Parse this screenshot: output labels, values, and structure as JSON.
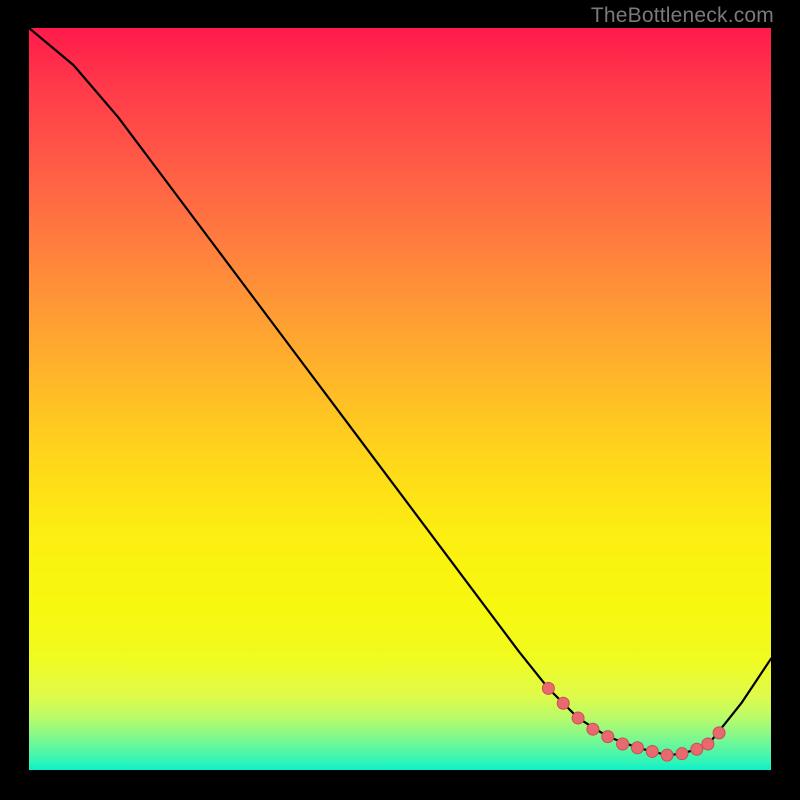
{
  "attribution": "TheBottleneck.com",
  "colors": {
    "curve_stroke": "#000000",
    "marker_fill": "#e86a6f",
    "marker_stroke": "#c94f55"
  },
  "chart_data": {
    "type": "line",
    "title": "",
    "xlabel": "",
    "ylabel": "",
    "xlim": [
      0,
      100
    ],
    "ylim": [
      0,
      100
    ],
    "series": [
      {
        "name": "curve",
        "x": [
          0,
          6,
          12,
          18,
          24,
          30,
          36,
          42,
          48,
          54,
          60,
          66,
          70,
          74,
          78,
          82,
          84,
          86,
          88,
          90,
          92,
          94,
          96,
          98,
          100
        ],
        "y": [
          100,
          95,
          88,
          80,
          72,
          64,
          56,
          48,
          40,
          32,
          24,
          16,
          11,
          7,
          4.5,
          3,
          2.5,
          2,
          2.2,
          2.8,
          4,
          6.5,
          9,
          12,
          15
        ]
      }
    ],
    "markers": {
      "name": "highlight-points",
      "x": [
        70,
        72,
        74,
        76,
        78,
        80,
        82,
        84,
        86,
        88,
        90,
        91.5,
        93
      ],
      "y": [
        11,
        9,
        7,
        5.5,
        4.5,
        3.5,
        3,
        2.5,
        2,
        2.2,
        2.8,
        3.5,
        5
      ]
    }
  }
}
